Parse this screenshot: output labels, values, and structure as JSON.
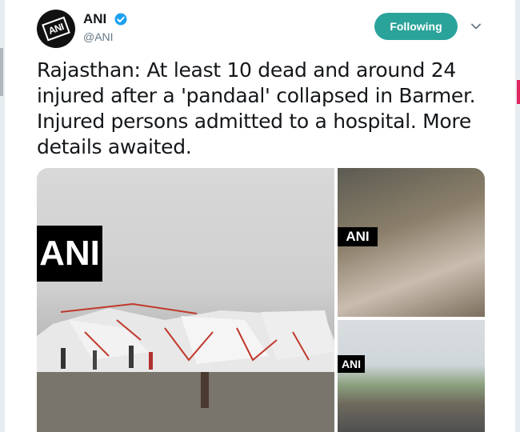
{
  "profile": {
    "display_name": "ANI",
    "handle": "@ANI",
    "avatar_text": "ANI"
  },
  "follow_button": {
    "label": "Following"
  },
  "tweet": {
    "lines": [
      "Rajasthan: At least 10 dead and around 24",
      "injured after a 'pandaal' collapsed in Barmer.",
      "Injured persons admitted to a hospital. More",
      "details awaited."
    ]
  },
  "media": {
    "watermark": "ANI"
  },
  "colors": {
    "follow_button_bg": "#2aa39a",
    "verified": "#1da1f2",
    "handle": "#657786"
  }
}
